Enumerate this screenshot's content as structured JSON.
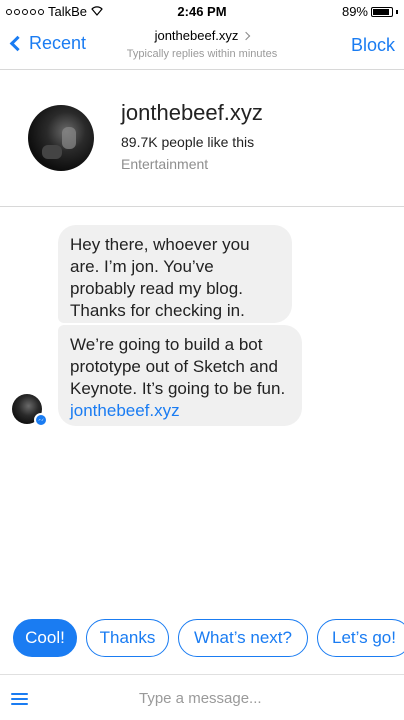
{
  "status_bar": {
    "carrier": "TalkBe",
    "time": "2:46 PM",
    "battery_percent": "89%",
    "battery_level": 0.89,
    "wifi_icon": "wifi-icon"
  },
  "nav": {
    "back_label": "Recent",
    "title": "jonthebeef.xyz",
    "subtitle": "Typically replies within minutes",
    "block_label": "Block"
  },
  "profile": {
    "name": "jonthebeef.xyz",
    "likes": "89.7K people like this",
    "category": "Entertainment"
  },
  "messages": [
    {
      "text": "Hey there, whoever you are. I’m jon. You’ve probably read my blog. Thanks for checking in."
    },
    {
      "text": "We’re going to build a bot prototype out of Sketch and Keynote. It’s going to be fun. ",
      "link": "jonthebeef.xyz"
    }
  ],
  "quick_replies": [
    "Cool!",
    "Thanks",
    "What’s next?",
    "Let’s go!"
  ],
  "composer": {
    "placeholder": "Type a message..."
  },
  "colors": {
    "accent": "#1a7cf2",
    "bubble_bg": "#f0f0f0"
  }
}
